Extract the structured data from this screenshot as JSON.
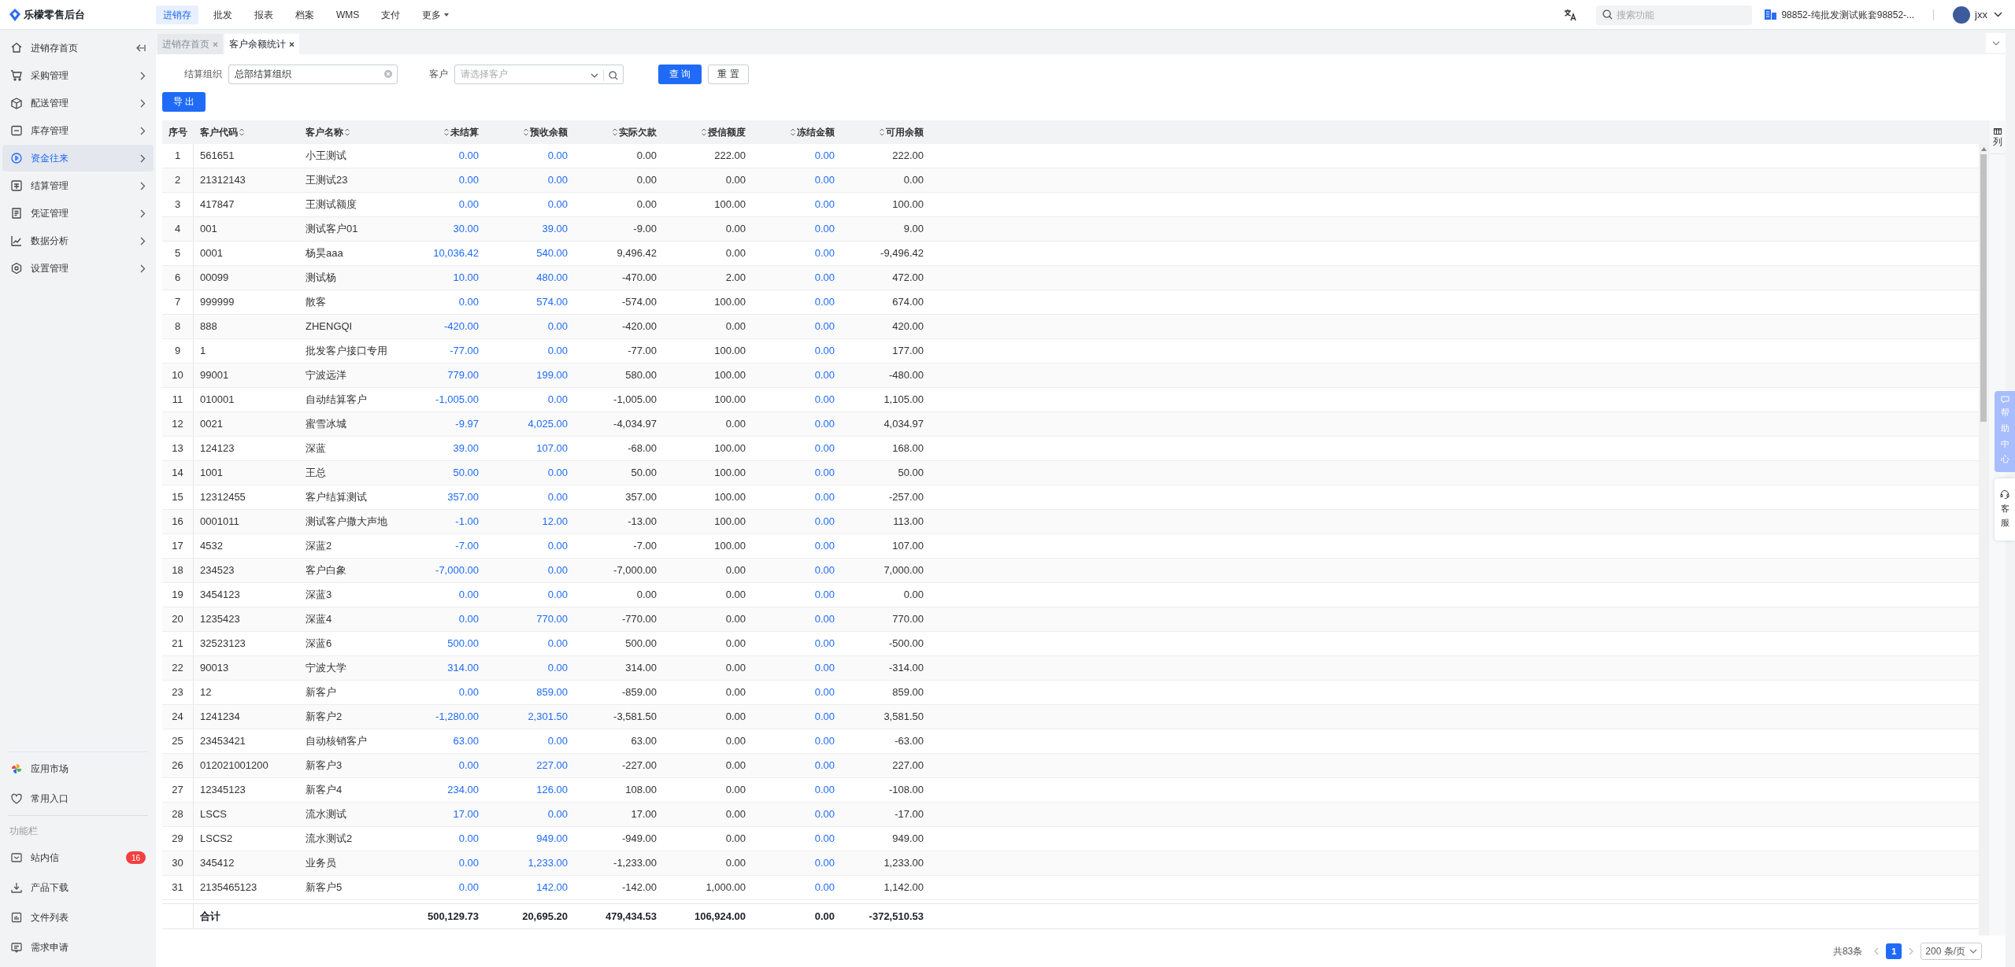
{
  "app": {
    "title": "乐檬零售后台"
  },
  "top_nav": [
    {
      "label": "进销存",
      "selected": true
    },
    {
      "label": "批发",
      "selected": false
    },
    {
      "label": "报表",
      "selected": false
    },
    {
      "label": "档案",
      "selected": false
    },
    {
      "label": "WMS",
      "selected": false
    },
    {
      "label": "支付",
      "selected": false
    },
    {
      "label": "更多",
      "selected": false
    }
  ],
  "header": {
    "search_placeholder": "搜索功能",
    "account": "98852-纯批发测试账套98852-...",
    "user": "jxx"
  },
  "sidebar": {
    "items": [
      {
        "label": "进销存首页",
        "selected": false
      },
      {
        "label": "采购管理",
        "selected": false
      },
      {
        "label": "配送管理",
        "selected": false
      },
      {
        "label": "库存管理",
        "selected": false
      },
      {
        "label": "资金往来",
        "selected": true
      },
      {
        "label": "结算管理",
        "selected": false
      },
      {
        "label": "凭证管理",
        "selected": false
      },
      {
        "label": "数据分析",
        "selected": false
      },
      {
        "label": "设置管理",
        "selected": false
      }
    ],
    "shortcuts": [
      {
        "label": "应用市场"
      },
      {
        "label": "常用入口"
      }
    ],
    "section_label": "功能栏",
    "tools": [
      {
        "label": "站内信",
        "badge": "16"
      },
      {
        "label": "产品下载"
      },
      {
        "label": "文件列表"
      },
      {
        "label": "需求申请"
      }
    ]
  },
  "tabs": [
    {
      "label": "进销存首页",
      "selected": false
    },
    {
      "label": "客户余额统计",
      "selected": true
    }
  ],
  "filters": [
    {
      "label": "结算组织",
      "value": "总部结算组织",
      "kind": "clearable"
    },
    {
      "label": "客户",
      "placeholder": "请选择客户",
      "kind": "select-search"
    }
  ],
  "buttons": {
    "query": "查 询",
    "reset": "重 置",
    "export": "导 出"
  },
  "table": {
    "columns": [
      {
        "label": "序号",
        "sortable": false,
        "kind": "index"
      },
      {
        "label": "客户代码",
        "sortable": true,
        "kind": "text"
      },
      {
        "label": "客户名称",
        "sortable": true,
        "kind": "text"
      },
      {
        "label": "未结算",
        "sortable": true,
        "kind": "link"
      },
      {
        "label": "预收余额",
        "sortable": true,
        "kind": "link"
      },
      {
        "label": "实际欠款",
        "sortable": true,
        "kind": "number"
      },
      {
        "label": "授信额度",
        "sortable": true,
        "kind": "number"
      },
      {
        "label": "冻结金额",
        "sortable": true,
        "kind": "link"
      },
      {
        "label": "可用余额",
        "sortable": true,
        "kind": "number"
      }
    ],
    "rows": [
      [
        "1",
        "561651",
        "小王测试",
        "0.00",
        "0.00",
        "0.00",
        "222.00",
        "0.00",
        "222.00"
      ],
      [
        "2",
        "21312143",
        "王测试23",
        "0.00",
        "0.00",
        "0.00",
        "0.00",
        "0.00",
        "0.00"
      ],
      [
        "3",
        "417847",
        "王测试额度",
        "0.00",
        "0.00",
        "0.00",
        "100.00",
        "0.00",
        "100.00"
      ],
      [
        "4",
        "001",
        "测试客户01",
        "30.00",
        "39.00",
        "-9.00",
        "0.00",
        "0.00",
        "9.00"
      ],
      [
        "5",
        "0001",
        "杨昊aaa",
        "10,036.42",
        "540.00",
        "9,496.42",
        "0.00",
        "0.00",
        "-9,496.42"
      ],
      [
        "6",
        "00099",
        "测试杨",
        "10.00",
        "480.00",
        "-470.00",
        "2.00",
        "0.00",
        "472.00"
      ],
      [
        "7",
        "999999",
        "散客",
        "0.00",
        "574.00",
        "-574.00",
        "100.00",
        "0.00",
        "674.00"
      ],
      [
        "8",
        "888",
        "ZHENGQI",
        "-420.00",
        "0.00",
        "-420.00",
        "0.00",
        "0.00",
        "420.00"
      ],
      [
        "9",
        "1",
        "批发客户接口专用",
        "-77.00",
        "0.00",
        "-77.00",
        "100.00",
        "0.00",
        "177.00"
      ],
      [
        "10",
        "99001",
        "宁波远洋",
        "779.00",
        "199.00",
        "580.00",
        "100.00",
        "0.00",
        "-480.00"
      ],
      [
        "11",
        "010001",
        "自动结算客户",
        "-1,005.00",
        "0.00",
        "-1,005.00",
        "100.00",
        "0.00",
        "1,105.00"
      ],
      [
        "12",
        "0021",
        "蜜雪冰城",
        "-9.97",
        "4,025.00",
        "-4,034.97",
        "0.00",
        "0.00",
        "4,034.97"
      ],
      [
        "13",
        "124123",
        "深蓝",
        "39.00",
        "107.00",
        "-68.00",
        "100.00",
        "0.00",
        "168.00"
      ],
      [
        "14",
        "1001",
        "王总",
        "50.00",
        "0.00",
        "50.00",
        "100.00",
        "0.00",
        "50.00"
      ],
      [
        "15",
        "12312455",
        "客户结算测试",
        "357.00",
        "0.00",
        "357.00",
        "100.00",
        "0.00",
        "-257.00"
      ],
      [
        "16",
        "0001011",
        "测试客户撒大声地",
        "-1.00",
        "12.00",
        "-13.00",
        "100.00",
        "0.00",
        "113.00"
      ],
      [
        "17",
        "4532",
        "深蓝2",
        "-7.00",
        "0.00",
        "-7.00",
        "100.00",
        "0.00",
        "107.00"
      ],
      [
        "18",
        "234523",
        "客户白象",
        "-7,000.00",
        "0.00",
        "-7,000.00",
        "0.00",
        "0.00",
        "7,000.00"
      ],
      [
        "19",
        "3454123",
        "深蓝3",
        "0.00",
        "0.00",
        "0.00",
        "0.00",
        "0.00",
        "0.00"
      ],
      [
        "20",
        "1235423",
        "深蓝4",
        "0.00",
        "770.00",
        "-770.00",
        "0.00",
        "0.00",
        "770.00"
      ],
      [
        "21",
        "32523123",
        "深蓝6",
        "500.00",
        "0.00",
        "500.00",
        "0.00",
        "0.00",
        "-500.00"
      ],
      [
        "22",
        "90013",
        "宁波大学",
        "314.00",
        "0.00",
        "314.00",
        "0.00",
        "0.00",
        "-314.00"
      ],
      [
        "23",
        "12",
        "新客户",
        "0.00",
        "859.00",
        "-859.00",
        "0.00",
        "0.00",
        "859.00"
      ],
      [
        "24",
        "1241234",
        "新客户2",
        "-1,280.00",
        "2,301.50",
        "-3,581.50",
        "0.00",
        "0.00",
        "3,581.50"
      ],
      [
        "25",
        "23453421",
        "自动核销客户",
        "63.00",
        "0.00",
        "63.00",
        "0.00",
        "0.00",
        "-63.00"
      ],
      [
        "26",
        "012021001200",
        "新客户3",
        "0.00",
        "227.00",
        "-227.00",
        "0.00",
        "0.00",
        "227.00"
      ],
      [
        "27",
        "12345123",
        "新客户4",
        "234.00",
        "126.00",
        "108.00",
        "0.00",
        "0.00",
        "-108.00"
      ],
      [
        "28",
        "LSCS",
        "流水测试",
        "17.00",
        "0.00",
        "17.00",
        "0.00",
        "0.00",
        "-17.00"
      ],
      [
        "29",
        "LSCS2",
        "流水测试2",
        "0.00",
        "949.00",
        "-949.00",
        "0.00",
        "0.00",
        "949.00"
      ],
      [
        "30",
        "345412",
        "业务员",
        "0.00",
        "1,233.00",
        "-1,233.00",
        "0.00",
        "0.00",
        "1,233.00"
      ],
      [
        "31",
        "2135465123",
        "新客户5",
        "0.00",
        "142.00",
        "-142.00",
        "1,000.00",
        "0.00",
        "1,142.00"
      ]
    ],
    "total_row": {
      "label": "合计",
      "values": [
        "500,129.73",
        "20,695.20",
        "479,434.53",
        "106,924.00",
        "0.00",
        "-372,510.53"
      ]
    }
  },
  "side_widgets": {
    "columns": "列",
    "help": "帮助中心",
    "service": "客服"
  },
  "pagination": {
    "total": "共83条",
    "pages": [
      {
        "label": "1",
        "selected": true
      }
    ],
    "page_size": "200 条/页"
  }
}
